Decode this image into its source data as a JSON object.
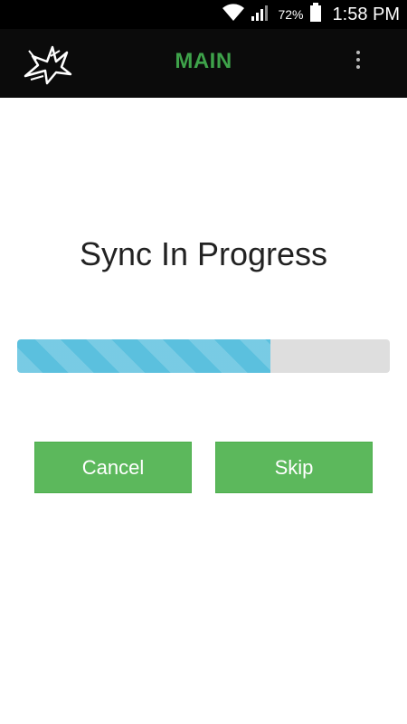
{
  "status_bar": {
    "battery_percent": "72%",
    "time": "1:58 PM",
    "icons": [
      "wifi-icon",
      "signal-icon",
      "battery-icon"
    ]
  },
  "action_bar": {
    "title": "MAIN",
    "logo": "app-logo",
    "menu_icon": "overflow-menu-icon",
    "title_color": "#3ea24a"
  },
  "main": {
    "heading": "Sync In Progress",
    "progress": 0.68,
    "progress_color": "#5bc0de",
    "buttons": {
      "cancel_label": "Cancel",
      "skip_label": "Skip",
      "button_color": "#5cb85c"
    }
  }
}
